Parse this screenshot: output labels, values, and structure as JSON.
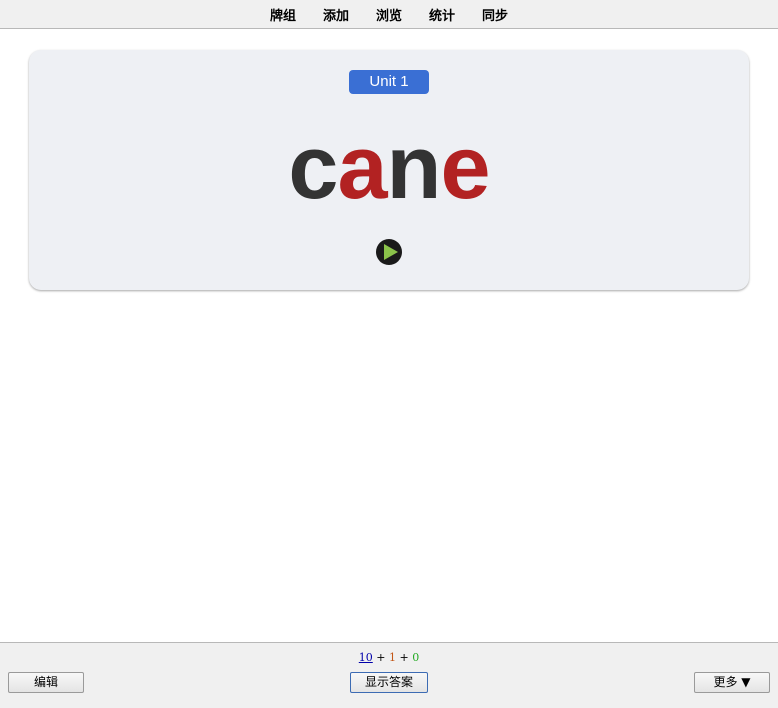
{
  "nav": {
    "items": [
      {
        "label": "牌组"
      },
      {
        "label": "添加"
      },
      {
        "label": "浏览"
      },
      {
        "label": "统计"
      },
      {
        "label": "同步"
      }
    ]
  },
  "card": {
    "badge": "Unit 1",
    "word_parts": [
      {
        "text": "c",
        "style": "dark"
      },
      {
        "text": "a",
        "style": "red"
      },
      {
        "text": "n",
        "style": "dark"
      },
      {
        "text": "e",
        "style": "red"
      }
    ],
    "colors": {
      "dark": "#333333",
      "red": "#b22222",
      "badge": "#3a6fd4",
      "play": "#8bc34a"
    },
    "audio_icon": "play-icon"
  },
  "footer": {
    "counts": {
      "new": "10",
      "learn": "1",
      "review": "0",
      "separator": "+"
    },
    "edit_label": "编辑",
    "show_answer_label": "显示答案",
    "more_label": "更多 ▼"
  }
}
